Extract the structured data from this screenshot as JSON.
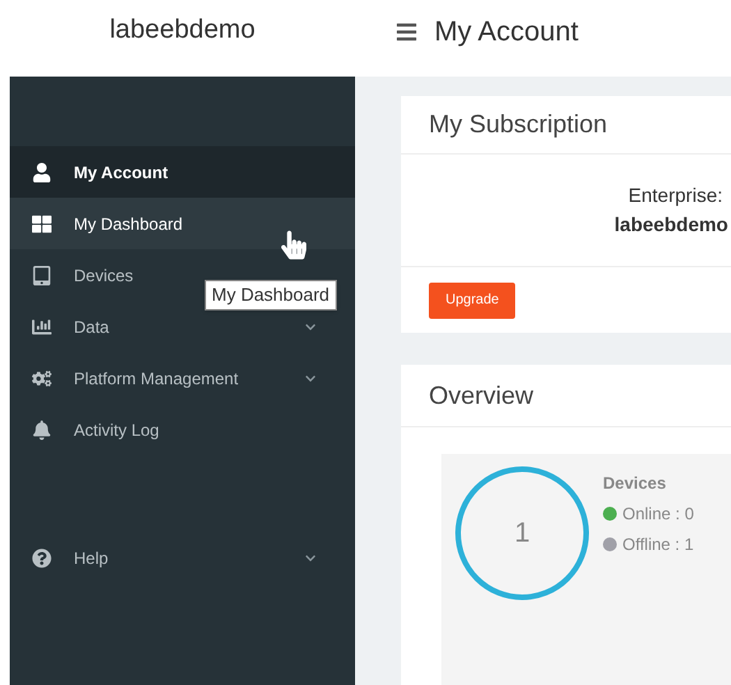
{
  "brand": "labeebdemo",
  "page_title": "My Account",
  "sidebar": {
    "items": [
      {
        "label": "My Account",
        "selected": true,
        "hovered": false,
        "submenu": false
      },
      {
        "label": "My Dashboard",
        "selected": false,
        "hovered": true,
        "submenu": false
      },
      {
        "label": "Devices",
        "selected": false,
        "hovered": false,
        "submenu": false
      },
      {
        "label": "Data",
        "selected": false,
        "hovered": false,
        "submenu": true
      },
      {
        "label": "Platform Management",
        "selected": false,
        "hovered": false,
        "submenu": true
      },
      {
        "label": "Activity Log",
        "selected": false,
        "hovered": false,
        "submenu": false
      }
    ],
    "bottom_items": [
      {
        "label": "Help",
        "selected": false,
        "hovered": false,
        "submenu": true
      }
    ]
  },
  "tooltip": "My Dashboard",
  "subscription": {
    "title": "My Subscription",
    "plan_label": "Enterprise:",
    "plan_name": "labeebdemo",
    "button": "Upgrade"
  },
  "overview": {
    "title": "Overview",
    "total": "1",
    "legend_title": "Devices",
    "legend": [
      {
        "label": "Online : 0",
        "color": "#4caf50"
      },
      {
        "label": "Offline : 1",
        "color": "#a0a0a8"
      }
    ]
  }
}
